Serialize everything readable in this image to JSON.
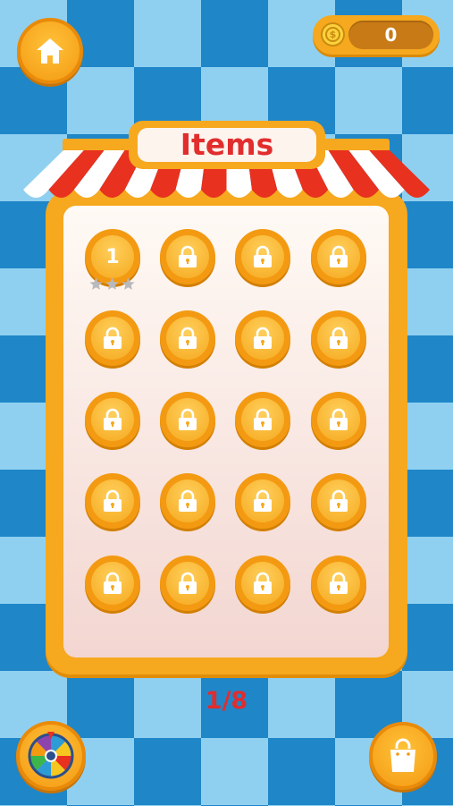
{
  "header": {
    "home_icon": "home-icon",
    "coins": {
      "icon": "dollar-coin-icon",
      "symbol": "$",
      "value": "0"
    }
  },
  "board": {
    "title": "Items",
    "levels": [
      {
        "label": "1",
        "state": "unlocked",
        "stars": 0,
        "max_stars": 3
      },
      {
        "state": "locked"
      },
      {
        "state": "locked"
      },
      {
        "state": "locked"
      },
      {
        "state": "locked"
      },
      {
        "state": "locked"
      },
      {
        "state": "locked"
      },
      {
        "state": "locked"
      },
      {
        "state": "locked"
      },
      {
        "state": "locked"
      },
      {
        "state": "locked"
      },
      {
        "state": "locked"
      },
      {
        "state": "locked"
      },
      {
        "state": "locked"
      },
      {
        "state": "locked"
      },
      {
        "state": "locked"
      },
      {
        "state": "locked"
      },
      {
        "state": "locked"
      },
      {
        "state": "locked"
      },
      {
        "state": "locked"
      }
    ]
  },
  "pagination": {
    "label": "1/8"
  },
  "footer": {
    "spin_icon": "prize-wheel-icon",
    "shop_icon": "shopping-bag-icon"
  },
  "colors": {
    "accent": "#f6a81e",
    "title_red": "#e12d2d",
    "awning_red": "#e8311f",
    "sky_light": "#8fd0f0",
    "sky_dark": "#1f86c8"
  }
}
